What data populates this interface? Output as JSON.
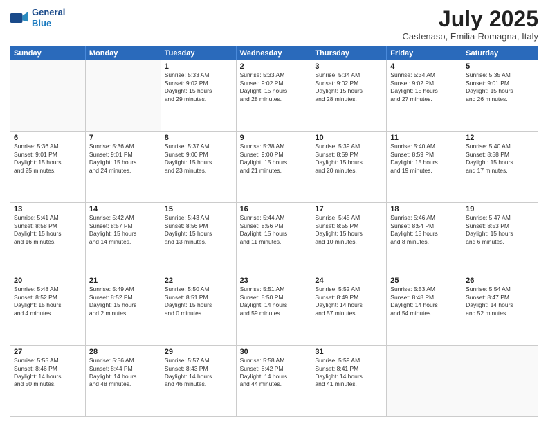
{
  "header": {
    "logo_line1": "General",
    "logo_line2": "Blue",
    "month": "July 2025",
    "location": "Castenaso, Emilia-Romagna, Italy"
  },
  "days_of_week": [
    "Sunday",
    "Monday",
    "Tuesday",
    "Wednesday",
    "Thursday",
    "Friday",
    "Saturday"
  ],
  "weeks": [
    [
      {
        "day": "",
        "lines": []
      },
      {
        "day": "",
        "lines": []
      },
      {
        "day": "1",
        "lines": [
          "Sunrise: 5:33 AM",
          "Sunset: 9:02 PM",
          "Daylight: 15 hours",
          "and 29 minutes."
        ]
      },
      {
        "day": "2",
        "lines": [
          "Sunrise: 5:33 AM",
          "Sunset: 9:02 PM",
          "Daylight: 15 hours",
          "and 28 minutes."
        ]
      },
      {
        "day": "3",
        "lines": [
          "Sunrise: 5:34 AM",
          "Sunset: 9:02 PM",
          "Daylight: 15 hours",
          "and 28 minutes."
        ]
      },
      {
        "day": "4",
        "lines": [
          "Sunrise: 5:34 AM",
          "Sunset: 9:02 PM",
          "Daylight: 15 hours",
          "and 27 minutes."
        ]
      },
      {
        "day": "5",
        "lines": [
          "Sunrise: 5:35 AM",
          "Sunset: 9:01 PM",
          "Daylight: 15 hours",
          "and 26 minutes."
        ]
      }
    ],
    [
      {
        "day": "6",
        "lines": [
          "Sunrise: 5:36 AM",
          "Sunset: 9:01 PM",
          "Daylight: 15 hours",
          "and 25 minutes."
        ]
      },
      {
        "day": "7",
        "lines": [
          "Sunrise: 5:36 AM",
          "Sunset: 9:01 PM",
          "Daylight: 15 hours",
          "and 24 minutes."
        ]
      },
      {
        "day": "8",
        "lines": [
          "Sunrise: 5:37 AM",
          "Sunset: 9:00 PM",
          "Daylight: 15 hours",
          "and 23 minutes."
        ]
      },
      {
        "day": "9",
        "lines": [
          "Sunrise: 5:38 AM",
          "Sunset: 9:00 PM",
          "Daylight: 15 hours",
          "and 21 minutes."
        ]
      },
      {
        "day": "10",
        "lines": [
          "Sunrise: 5:39 AM",
          "Sunset: 8:59 PM",
          "Daylight: 15 hours",
          "and 20 minutes."
        ]
      },
      {
        "day": "11",
        "lines": [
          "Sunrise: 5:40 AM",
          "Sunset: 8:59 PM",
          "Daylight: 15 hours",
          "and 19 minutes."
        ]
      },
      {
        "day": "12",
        "lines": [
          "Sunrise: 5:40 AM",
          "Sunset: 8:58 PM",
          "Daylight: 15 hours",
          "and 17 minutes."
        ]
      }
    ],
    [
      {
        "day": "13",
        "lines": [
          "Sunrise: 5:41 AM",
          "Sunset: 8:58 PM",
          "Daylight: 15 hours",
          "and 16 minutes."
        ]
      },
      {
        "day": "14",
        "lines": [
          "Sunrise: 5:42 AM",
          "Sunset: 8:57 PM",
          "Daylight: 15 hours",
          "and 14 minutes."
        ]
      },
      {
        "day": "15",
        "lines": [
          "Sunrise: 5:43 AM",
          "Sunset: 8:56 PM",
          "Daylight: 15 hours",
          "and 13 minutes."
        ]
      },
      {
        "day": "16",
        "lines": [
          "Sunrise: 5:44 AM",
          "Sunset: 8:56 PM",
          "Daylight: 15 hours",
          "and 11 minutes."
        ]
      },
      {
        "day": "17",
        "lines": [
          "Sunrise: 5:45 AM",
          "Sunset: 8:55 PM",
          "Daylight: 15 hours",
          "and 10 minutes."
        ]
      },
      {
        "day": "18",
        "lines": [
          "Sunrise: 5:46 AM",
          "Sunset: 8:54 PM",
          "Daylight: 15 hours",
          "and 8 minutes."
        ]
      },
      {
        "day": "19",
        "lines": [
          "Sunrise: 5:47 AM",
          "Sunset: 8:53 PM",
          "Daylight: 15 hours",
          "and 6 minutes."
        ]
      }
    ],
    [
      {
        "day": "20",
        "lines": [
          "Sunrise: 5:48 AM",
          "Sunset: 8:52 PM",
          "Daylight: 15 hours",
          "and 4 minutes."
        ]
      },
      {
        "day": "21",
        "lines": [
          "Sunrise: 5:49 AM",
          "Sunset: 8:52 PM",
          "Daylight: 15 hours",
          "and 2 minutes."
        ]
      },
      {
        "day": "22",
        "lines": [
          "Sunrise: 5:50 AM",
          "Sunset: 8:51 PM",
          "Daylight: 15 hours",
          "and 0 minutes."
        ]
      },
      {
        "day": "23",
        "lines": [
          "Sunrise: 5:51 AM",
          "Sunset: 8:50 PM",
          "Daylight: 14 hours",
          "and 59 minutes."
        ]
      },
      {
        "day": "24",
        "lines": [
          "Sunrise: 5:52 AM",
          "Sunset: 8:49 PM",
          "Daylight: 14 hours",
          "and 57 minutes."
        ]
      },
      {
        "day": "25",
        "lines": [
          "Sunrise: 5:53 AM",
          "Sunset: 8:48 PM",
          "Daylight: 14 hours",
          "and 54 minutes."
        ]
      },
      {
        "day": "26",
        "lines": [
          "Sunrise: 5:54 AM",
          "Sunset: 8:47 PM",
          "Daylight: 14 hours",
          "and 52 minutes."
        ]
      }
    ],
    [
      {
        "day": "27",
        "lines": [
          "Sunrise: 5:55 AM",
          "Sunset: 8:46 PM",
          "Daylight: 14 hours",
          "and 50 minutes."
        ]
      },
      {
        "day": "28",
        "lines": [
          "Sunrise: 5:56 AM",
          "Sunset: 8:44 PM",
          "Daylight: 14 hours",
          "and 48 minutes."
        ]
      },
      {
        "day": "29",
        "lines": [
          "Sunrise: 5:57 AM",
          "Sunset: 8:43 PM",
          "Daylight: 14 hours",
          "and 46 minutes."
        ]
      },
      {
        "day": "30",
        "lines": [
          "Sunrise: 5:58 AM",
          "Sunset: 8:42 PM",
          "Daylight: 14 hours",
          "and 44 minutes."
        ]
      },
      {
        "day": "31",
        "lines": [
          "Sunrise: 5:59 AM",
          "Sunset: 8:41 PM",
          "Daylight: 14 hours",
          "and 41 minutes."
        ]
      },
      {
        "day": "",
        "lines": []
      },
      {
        "day": "",
        "lines": []
      }
    ]
  ]
}
